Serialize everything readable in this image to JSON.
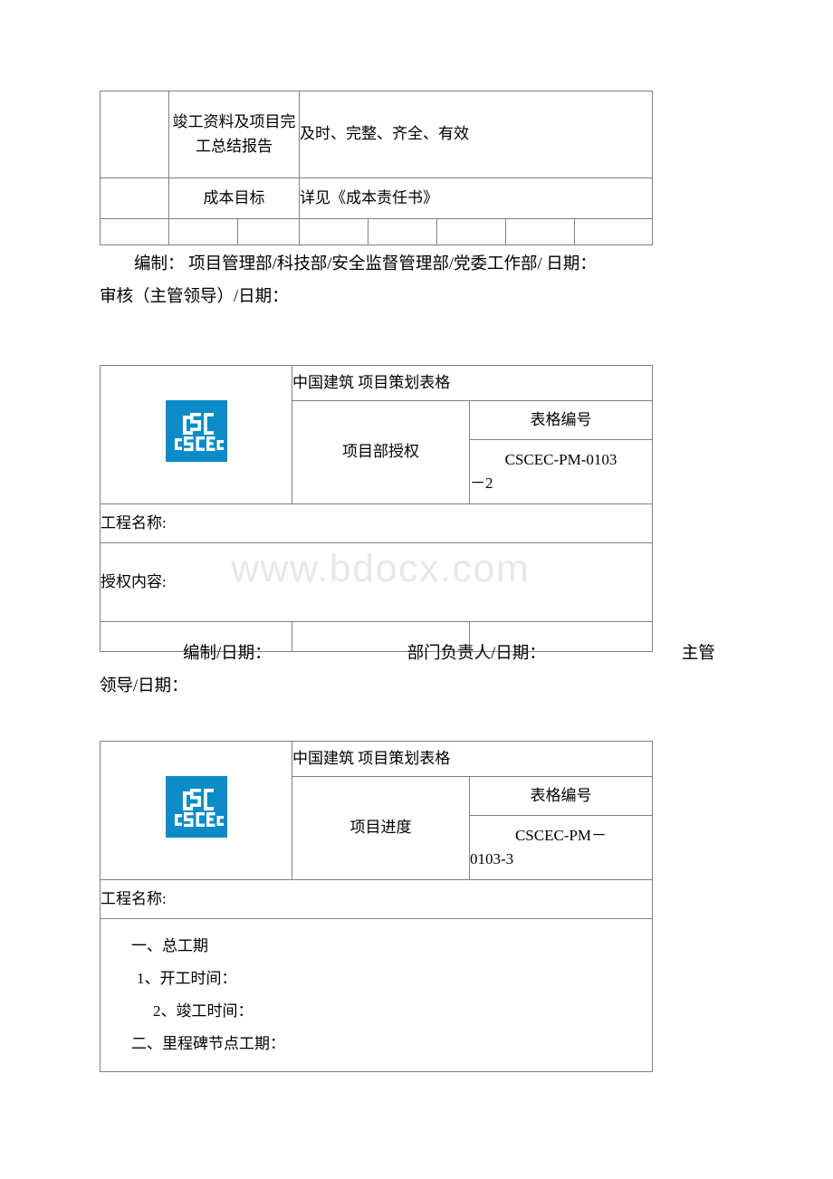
{
  "page": {
    "background": "#ffffff",
    "watermark": "www.bdocx.com",
    "watermark_color": "#e8e8e8",
    "rule_color": "#808080",
    "text_color": "#000000"
  },
  "table_one": {
    "rows": [
      {
        "label": "竣工资料及项目完工总结报告",
        "value": "及时、完整、齐全、有效"
      },
      {
        "label": "成本目标",
        "value": "详见《成本责任书》"
      }
    ],
    "footer_cells": [
      "",
      "",
      "",
      "",
      "",
      "",
      "",
      ""
    ]
  },
  "signature_one": {
    "line1": "编制： 项目管理部/科技部/安全监督管理部/党委工作部/ 日期：",
    "line2": "审核（主管领导）/日期："
  },
  "table_two": {
    "logo": {
      "name": "cscec-logo",
      "text": "CSCEC",
      "color": "#0b8cc9"
    },
    "title": "中国建筑 项目策划表格",
    "subject": "项目部授权",
    "form_no_label": "表格编号",
    "form_no_line1": "CSCEC-PM-0103",
    "form_no_line2": "－2",
    "project_name_label": "工程名称:",
    "content_label": "授权内容:",
    "footer_cells": [
      "",
      "",
      ""
    ]
  },
  "signature_two": {
    "line1_part1": "编制/日期：",
    "line1_part2": "部门负责人/日期：",
    "line1_part3": "主管",
    "line2": "领导/日期："
  },
  "table_three": {
    "logo": {
      "name": "cscec-logo",
      "text": "CSCEC",
      "color": "#0b8cc9"
    },
    "title": "中国建筑 项目策划表格",
    "subject": "项目进度",
    "form_no_label": "表格编号",
    "form_no_line1": "CSCEC-PM－",
    "form_no_line2": "0103-3",
    "project_name_label": "工程名称:",
    "body_lines": [
      {
        "text": "一、总工期",
        "indent": 0
      },
      {
        "text": "1、开工时间：",
        "indent": 1
      },
      {
        "text": "2、竣工时间：",
        "indent": 2
      },
      {
        "text": "二、里程碑节点工期：",
        "indent": 0
      }
    ]
  }
}
